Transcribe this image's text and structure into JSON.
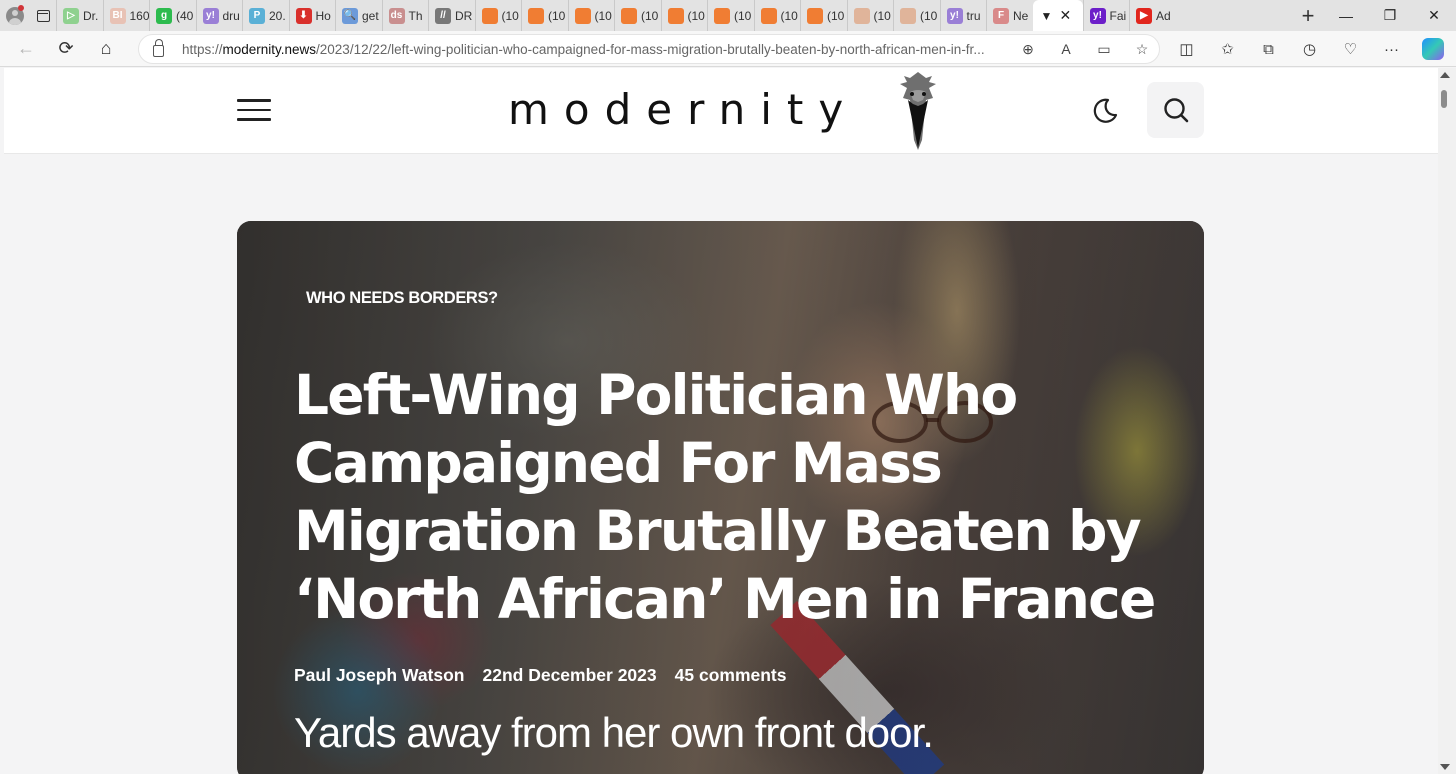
{
  "browser": {
    "tabs": [
      {
        "label": "Dr.",
        "icon": "play-icon",
        "color": "#8fd18f"
      },
      {
        "label": "160",
        "icon": "bi-icon",
        "color": "#e8c2b5"
      },
      {
        "label": "(40",
        "icon": "g-icon",
        "color": "#2dbb4e"
      },
      {
        "label": "dru",
        "icon": "yahoo-icon",
        "color": "#9a7fd6"
      },
      {
        "label": "20.",
        "icon": "p-icon",
        "color": "#5ab0d6"
      },
      {
        "label": "Ho",
        "icon": "download-icon",
        "color": "#d9302c"
      },
      {
        "label": "get",
        "icon": "search-icon",
        "color": "#6c9ad9"
      },
      {
        "label": "Th",
        "icon": "ds-icon",
        "color": "#c98f8f"
      },
      {
        "label": "DR",
        "icon": "slash-icon",
        "color": "#777777"
      },
      {
        "label": "(10",
        "icon": "bookmark-icon",
        "color": "#f07d33"
      },
      {
        "label": "(10",
        "icon": "bookmark-icon",
        "color": "#f07d33"
      },
      {
        "label": "(10",
        "icon": "bookmark-icon",
        "color": "#f07d33"
      },
      {
        "label": "(10",
        "icon": "bookmark-icon",
        "color": "#f07d33"
      },
      {
        "label": "(10",
        "icon": "bookmark-icon",
        "color": "#f07d33"
      },
      {
        "label": "(10",
        "icon": "bookmark-icon",
        "color": "#f07d33"
      },
      {
        "label": "(10",
        "icon": "bookmark-icon",
        "color": "#f07d33"
      },
      {
        "label": "(10",
        "icon": "bookmark-icon",
        "color": "#f07d33"
      },
      {
        "label": "(10",
        "icon": "bookmark-icon",
        "color": "#e0b49a"
      },
      {
        "label": "(10",
        "icon": "bookmark-icon",
        "color": "#e0b49a"
      },
      {
        "label": "tru",
        "icon": "yahoo-icon",
        "color": "#9a7fd6"
      },
      {
        "label": "Ne",
        "icon": "f-icon",
        "color": "#d98a8a"
      }
    ],
    "active_tab": {
      "icon": "bird-icon",
      "close": "✕"
    },
    "tabs_after": [
      {
        "label": "Fai",
        "icon": "yahoo-icon",
        "color": "#6c1fc9"
      },
      {
        "label": "Ad",
        "icon": "youtube-icon",
        "color": "#e1261d"
      }
    ],
    "new_tab": "+",
    "window_controls": {
      "minimize": "—",
      "restore": "❐",
      "close": "✕"
    },
    "url_scheme": "https://",
    "url_host": "modernity.news",
    "url_path": "/2023/12/22/left-wing-politician-who-campaigned-for-mass-migration-brutally-beaten-by-north-african-men-in-fr..."
  },
  "site": {
    "logo_text": "modernity"
  },
  "article": {
    "category": "WHO NEEDS BORDERS?",
    "title": "Left-Wing Politician Who Campaigned For Mass Migration Brutally Beaten by ‘North African’ Men in France",
    "author": "Paul Joseph Watson",
    "date": "22nd December 2023",
    "comments": "45 comments",
    "subtitle": "Yards away from her own front door."
  }
}
